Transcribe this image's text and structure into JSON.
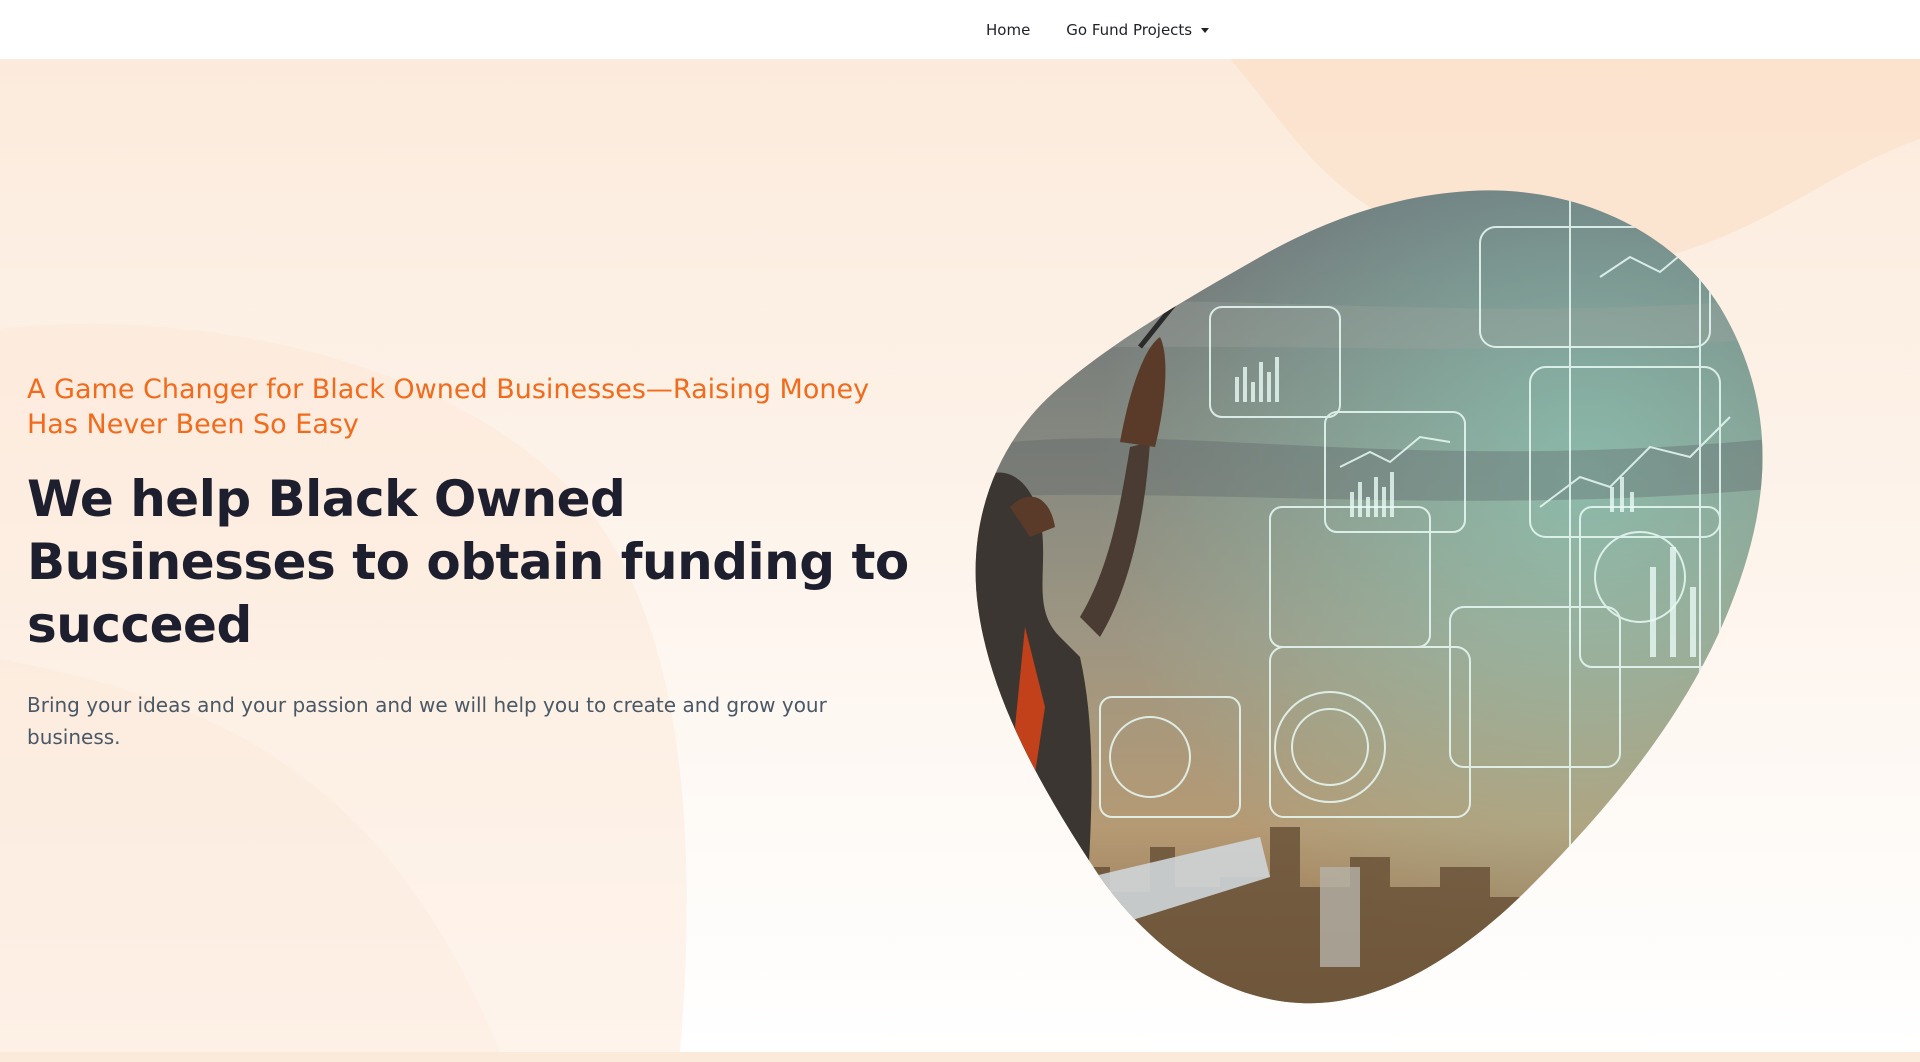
{
  "nav": {
    "items": [
      {
        "label": "Home",
        "has_dropdown": false
      },
      {
        "label": "Go Fund Projects",
        "has_dropdown": true
      }
    ],
    "dropdown_icon": "caret-down-icon"
  },
  "hero": {
    "tagline": "A Game Changer for Black Owned Businesses—Raising Money Has Never Been So Easy",
    "headline": "We help Black Owned Businesses to obtain funding to succeed",
    "subtext": "Bring your ideas and your passion and we will help you to create and grow your business.",
    "image_subject": "businessman-with-digital-data-overlay"
  },
  "colors": {
    "accent": "#f26a1b",
    "headline": "#1d1f2e",
    "body_text": "#4a5866",
    "nav_bg": "#ffffff",
    "hero_bg": "#fcebdc"
  }
}
